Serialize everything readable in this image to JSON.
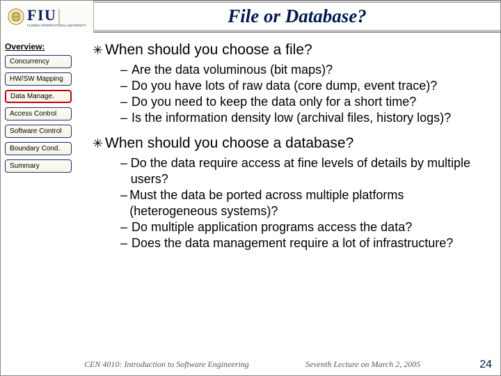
{
  "title": "File or Database?",
  "overview_label": "Overview:",
  "sidebar": {
    "items": [
      {
        "label": "Concurrency",
        "active": false
      },
      {
        "label": "HW/SW Mapping",
        "active": false
      },
      {
        "label": "Data Manage.",
        "active": true
      },
      {
        "label": "Access Control",
        "active": false
      },
      {
        "label": "Software Control",
        "active": false
      },
      {
        "label": "Boundary Cond.",
        "active": false
      },
      {
        "label": "Summary",
        "active": false
      }
    ]
  },
  "content": {
    "topics": [
      {
        "question": "When should you  choose a file?",
        "subs": [
          "Are the data voluminous (bit maps)?",
          "Do you have lots of raw data (core dump, event trace)?",
          "Do you need to keep the data only for a short time?",
          "Is the information density low (archival files, history logs)?"
        ]
      },
      {
        "question": "When should you choose a database?",
        "subs": [
          "Do the data require access at fine levels of details by multiple users?",
          "Must the data be ported across multiple platforms (heterogeneous systems)?",
          "Do multiple application programs access the data?",
          "Does the data management require a lot of infrastructure?"
        ]
      }
    ]
  },
  "footer": {
    "course": "CEN 4010: Introduction to Software Engineering",
    "lecture": "Seventh Lecture on March 2, 2005",
    "page": "24"
  },
  "logo": {
    "alt": "FIU Florida International University"
  }
}
